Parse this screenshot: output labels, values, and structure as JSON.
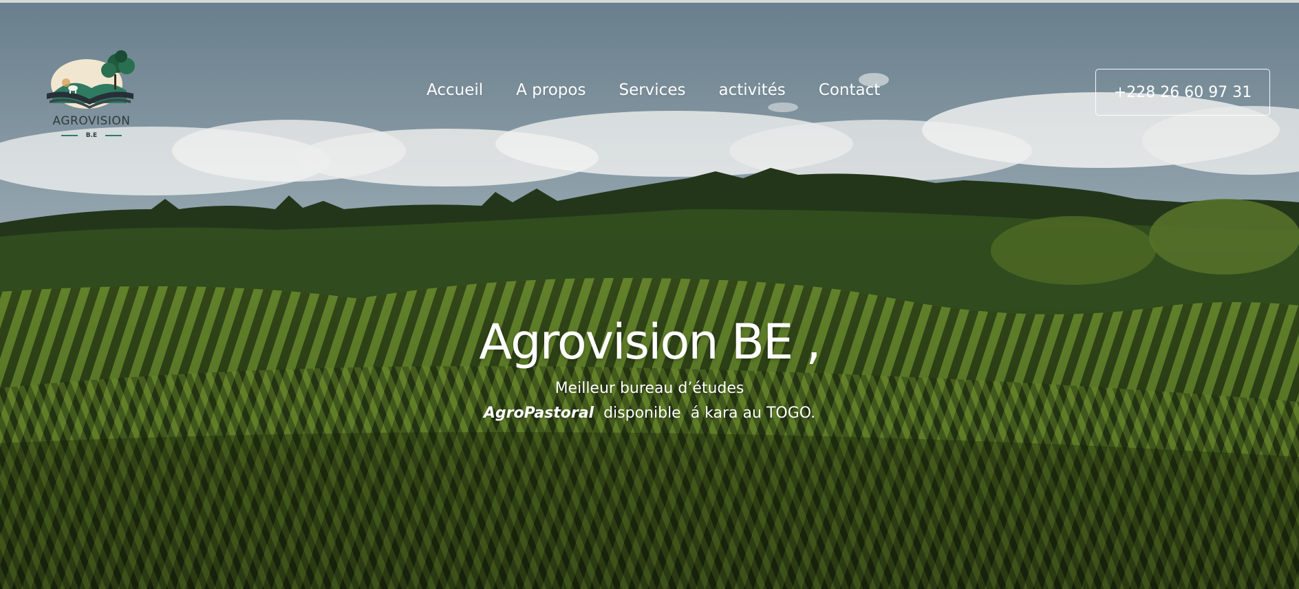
{
  "logo": {
    "name": "AGROVISION",
    "sub": "B.E"
  },
  "nav": {
    "items": [
      {
        "label": "Accueil"
      },
      {
        "label": "A propos"
      },
      {
        "label": "Services"
      },
      {
        "label": "activités"
      },
      {
        "label": "Contact"
      }
    ]
  },
  "header": {
    "phone": "+228 26 60 97 31"
  },
  "hero": {
    "title": "Agrovision BE ,",
    "line1": "Meilleur bureau d’études",
    "line2_emphasis": "AgroPastoral",
    "line2_rest": "  disponible  á kara au TOGO."
  },
  "colors": {
    "accent": "#2e7b62",
    "nav_text": "#ffffff",
    "logo_text": "#2f3a3c"
  },
  "icons": {
    "logo": "book-tree-landscape-logo"
  }
}
